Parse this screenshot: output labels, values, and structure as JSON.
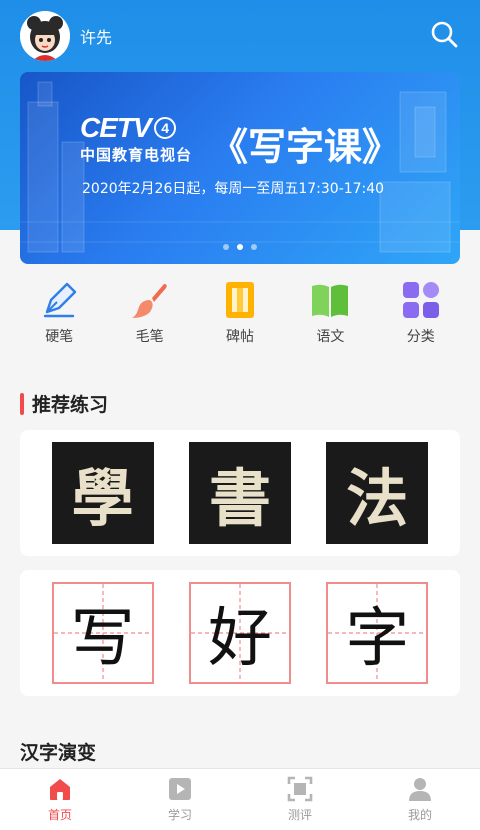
{
  "header": {
    "user_name": "许先",
    "search_icon": "search-icon",
    "avatar": "avatar"
  },
  "banner": {
    "logo_text": "CETV",
    "logo_number": "4",
    "channel_name": "中国教育电视台",
    "title": "《写字课》",
    "subtitle": "2020年2月26日起，每周一至周五17:30-17:40",
    "active_dot": 1,
    "dot_count": 3
  },
  "categories": [
    {
      "label": "硬笔",
      "icon": "fountain-pen-icon"
    },
    {
      "label": "毛笔",
      "icon": "brush-icon"
    },
    {
      "label": "碑帖",
      "icon": "tablet-icon"
    },
    {
      "label": "语文",
      "icon": "book-icon"
    },
    {
      "label": "分类",
      "icon": "grid-category-icon"
    }
  ],
  "recommend": {
    "title": "推荐练习",
    "calligraphy": [
      "學",
      "書",
      "法"
    ],
    "practice": [
      "写",
      "好",
      "字"
    ]
  },
  "evolution": {
    "title": "汉字演变"
  },
  "tabbar": [
    {
      "label": "首页",
      "icon": "home-icon",
      "active": true
    },
    {
      "label": "学习",
      "icon": "play-icon",
      "active": false
    },
    {
      "label": "测评",
      "icon": "scan-icon",
      "active": false
    },
    {
      "label": "我的",
      "icon": "user-icon",
      "active": false
    }
  ],
  "colors": {
    "primary_blue": "#1f8ee8",
    "accent_red": "#f24b4b",
    "grid_pink": "#f08c8c"
  }
}
